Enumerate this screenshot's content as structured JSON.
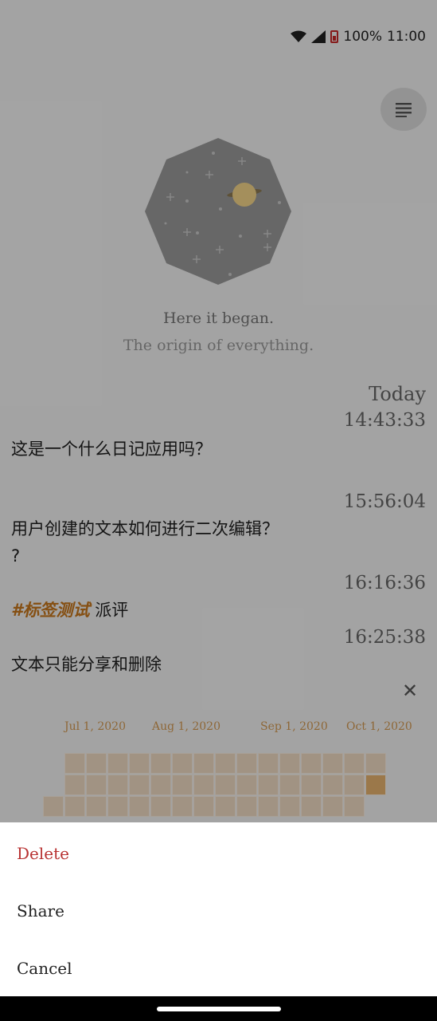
{
  "status_bar": {
    "battery": "100%",
    "time": "11:00"
  },
  "header": {
    "menu_icon": "menu-lines-icon"
  },
  "hero": {
    "icon": "octagon-space-planet-icon",
    "line1": "Here it began.",
    "line2": "The origin of everything."
  },
  "diary": {
    "day_label": "Today",
    "entries": [
      {
        "time": "14:43:33",
        "text": "这是一个什么日记应用吗？"
      },
      {
        "time": "15:56:04",
        "text_line1": "用户创建的文本如何进行二次编辑？",
        "text_line2": "?"
      },
      {
        "time": "16:16:36",
        "tag": "#标签测试",
        "text": " 派评"
      },
      {
        "time": "16:25:38",
        "text": "文本只能分享和删除"
      }
    ]
  },
  "heatmap": {
    "close_icon": "close-icon",
    "months": [
      "Jul 1, 2020",
      "Aug 1, 2020",
      "Sep 1, 2020",
      "Oct 1, 2020"
    ],
    "colors": {
      "empty": "#f0dcc3",
      "active": "#e7b36f"
    }
  },
  "action_sheet": {
    "delete_label": "Delete",
    "share_label": "Share",
    "cancel_label": "Cancel"
  },
  "colors": {
    "accent": "#c7771c",
    "danger": "#b83232"
  }
}
